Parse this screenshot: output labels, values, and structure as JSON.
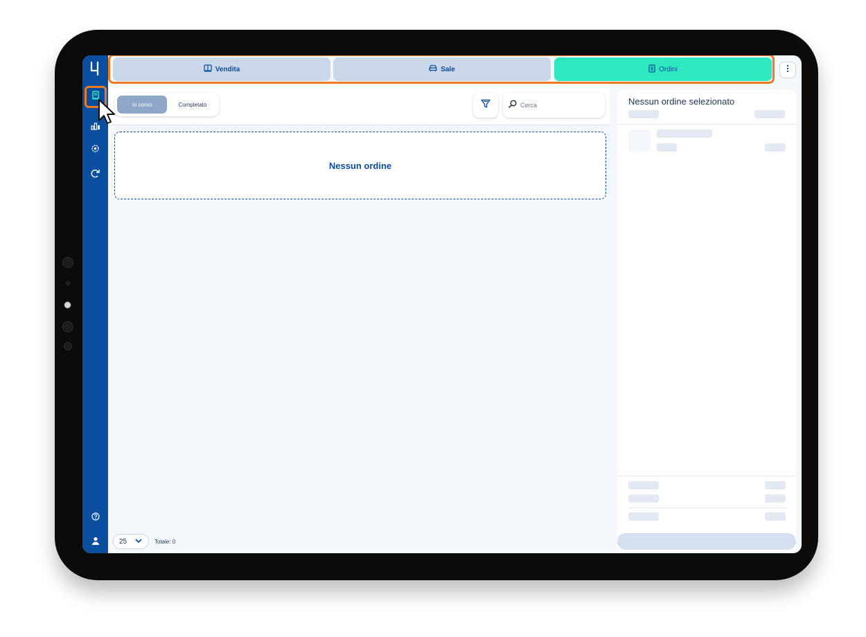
{
  "tabs": [
    {
      "label": "Vendita",
      "icon": "book-icon",
      "active": false
    },
    {
      "label": "Sale",
      "icon": "sofa-icon",
      "active": false
    },
    {
      "label": "Ordini",
      "icon": "receipt-icon",
      "active": true
    }
  ],
  "filters": {
    "in_progress": "In corso",
    "completed": "Completato",
    "selected": "In corso"
  },
  "search": {
    "placeholder": "Cerca",
    "value": ""
  },
  "orders": {
    "empty_text": "Nessun ordine"
  },
  "footer": {
    "page_size": "25",
    "total": "Totale: 0"
  },
  "detail": {
    "title": "Nessun ordine selezionato"
  },
  "colors": {
    "nav": "#0a4ea0",
    "active_tab": "#2ee8c0",
    "tab": "#c9d7e9",
    "highlight": "#f0791e",
    "background": "#f4f7fb"
  },
  "nav_icons": [
    "logo-icon",
    "orders-icon",
    "stats-icon",
    "settings-icon",
    "refresh-icon",
    "help-icon",
    "user-icon"
  ]
}
